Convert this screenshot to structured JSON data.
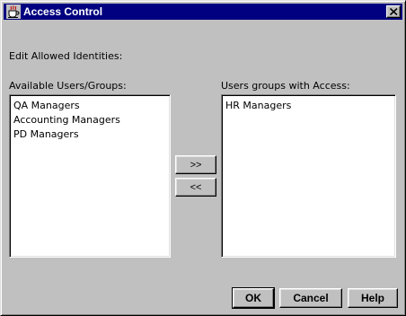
{
  "window": {
    "title": "Access Control",
    "close_symbol": "×"
  },
  "icons": {
    "title_icon": "coffee-cup-icon",
    "close_icon": "close-icon"
  },
  "form": {
    "edit_label": "Edit Allowed Identities:",
    "available_label": "Available Users/Groups:",
    "access_label": "Users groups with Access:"
  },
  "available": {
    "items": [
      {
        "label": "QA Managers"
      },
      {
        "label": "Accounting Managers"
      },
      {
        "label": "PD Managers"
      }
    ]
  },
  "access": {
    "items": [
      {
        "label": "HR Managers"
      }
    ]
  },
  "transfer": {
    "add_label": ">>",
    "remove_label": "<<"
  },
  "footer": {
    "ok_label": "OK",
    "cancel_label": "Cancel",
    "help_label": "Help"
  },
  "colors": {
    "title_bar": "#000080",
    "window_bg": "#c0c0c0",
    "list_bg": "#ffffff"
  }
}
